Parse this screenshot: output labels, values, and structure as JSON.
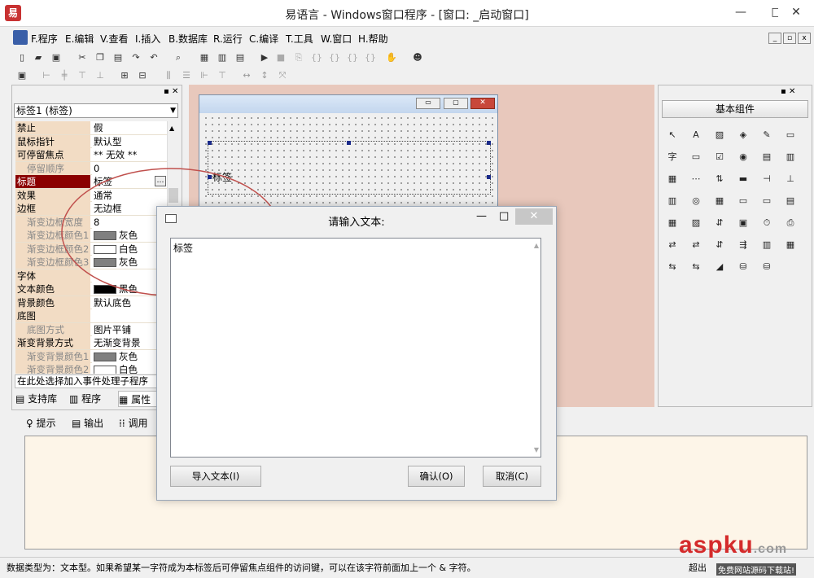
{
  "window": {
    "title": "易语言 - Windows窗口程序 - [窗口: _启动窗口]",
    "minimize": "—",
    "maximize": "□",
    "close": "✕"
  },
  "menu": [
    "F.程序",
    "E.编辑",
    "V.查看",
    "I.插入",
    "B.数据库",
    "R.运行",
    "C.编译",
    "T.工具",
    "W.窗口",
    "H.帮助"
  ],
  "mdi": {
    "minimize": "_",
    "restore": "▫",
    "close": "x"
  },
  "properties": {
    "selector": "标签1 (标签)",
    "rows": [
      {
        "name": "禁止",
        "value": "假",
        "sub": false
      },
      {
        "name": "鼠标指针",
        "value": "默认型",
        "sub": false
      },
      {
        "name": "可停留焦点",
        "value": "** 无效 **",
        "sub": false
      },
      {
        "name": "停留顺序",
        "value": "0",
        "sub": true
      },
      {
        "name": "标题",
        "value": "标签",
        "sub": false,
        "selected": true
      },
      {
        "name": "效果",
        "value": "通常",
        "sub": false
      },
      {
        "name": "边框",
        "value": "无边框",
        "sub": false
      },
      {
        "name": "渐变边框宽度",
        "value": "8",
        "sub": true
      },
      {
        "name": "渐变边框颜色1",
        "value": "灰色",
        "sub": true,
        "swatch": "#808080"
      },
      {
        "name": "渐变边框颜色2",
        "value": "白色",
        "sub": true,
        "swatch": "#ffffff"
      },
      {
        "name": "渐变边框颜色3",
        "value": "灰色",
        "sub": true,
        "swatch": "#808080"
      },
      {
        "name": "字体",
        "value": "",
        "sub": false
      },
      {
        "name": "文本颜色",
        "value": "黑色",
        "sub": false,
        "swatch": "#000000"
      },
      {
        "name": "背景颜色",
        "value": "默认底色",
        "sub": false
      },
      {
        "name": "底图",
        "value": "",
        "sub": false
      },
      {
        "name": "底图方式",
        "value": "图片平铺",
        "sub": true
      },
      {
        "name": "渐变背景方式",
        "value": "无渐变背景",
        "sub": false
      },
      {
        "name": "渐变背景颜色1",
        "value": "灰色",
        "sub": true,
        "swatch": "#808080"
      },
      {
        "name": "渐变背景颜色2",
        "value": "白色",
        "sub": true,
        "swatch": "#ffffff"
      }
    ],
    "ellipsis": "…",
    "event_selector": "在此处选择加入事件处理子程序",
    "tabs": [
      "支持库",
      "程序",
      "属性"
    ]
  },
  "designer": {
    "label_text": "标签"
  },
  "output": {
    "tabs": [
      "提示",
      "输出",
      "调用"
    ]
  },
  "components": {
    "header": "基本组件"
  },
  "dialog": {
    "title": "请输入文本:",
    "text": "标签",
    "import_button": "导入文本(I)",
    "ok_button": "确认(O)",
    "cancel_button": "取消(C)"
  },
  "statusbar": {
    "text": "数据类型为：文本型。如果希望某一字符成为本标签后可停留焦点组件的访问键，可以在该字符前面加上一个 & 字符。",
    "right": "超出",
    "watermark": "aspku",
    "watermark_suffix": ".com",
    "watermark_sub": "免费网站源码下载站!"
  }
}
